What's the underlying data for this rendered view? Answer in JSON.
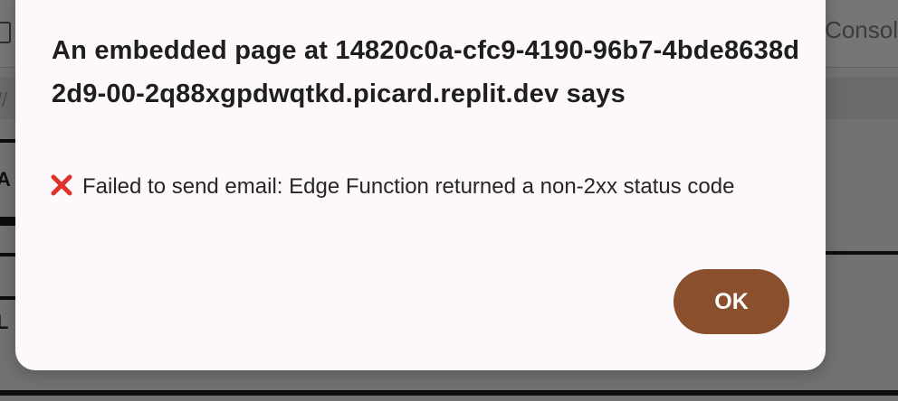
{
  "background": {
    "tab_label": "Consol",
    "url_fragment": "//",
    "label_a": "A",
    "label_l": "L"
  },
  "dialog": {
    "title": "An embedded page at 14820c0a-cfc9-4190-96b7-4bde8638d2d9-00-2q88xgpdwqtkd.picard.replit.dev says",
    "message_icon": "cross-mark-icon",
    "message": "Failed to send email: Edge Function returned a non-2xx status code",
    "ok_label": "OK"
  },
  "colors": {
    "dialog_bg": "#fdf8fb",
    "ok_button": "#8a4f2d",
    "error_icon": "#e0312a"
  }
}
